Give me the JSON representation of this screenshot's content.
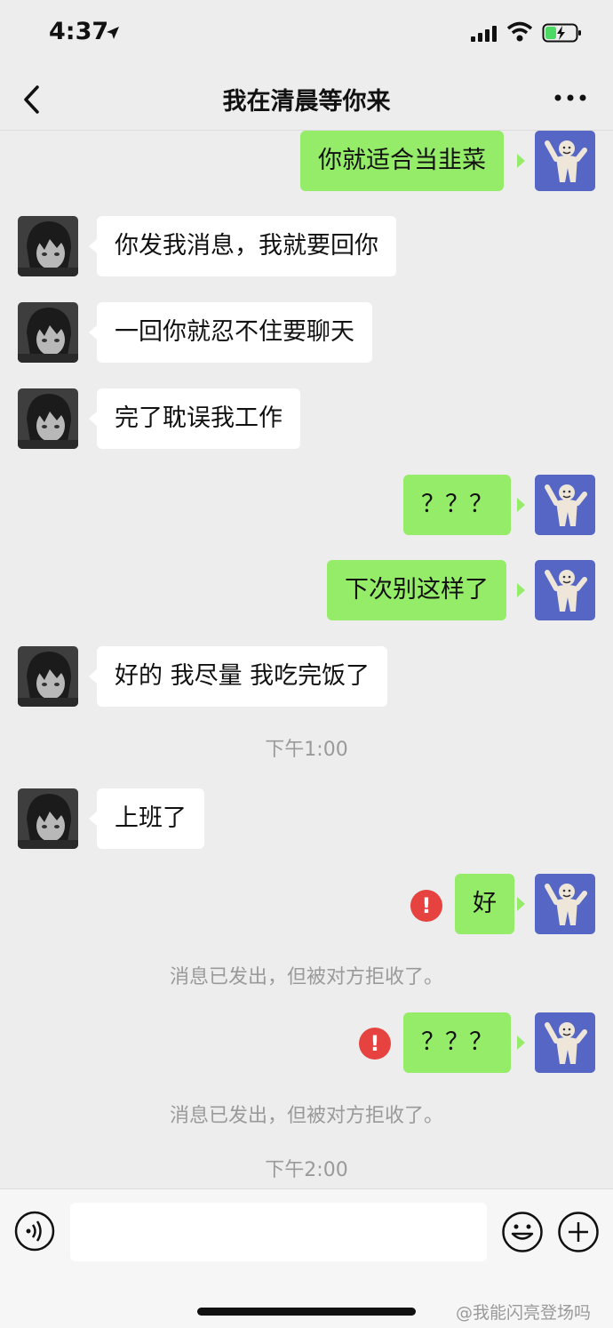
{
  "status": {
    "time": "4:37"
  },
  "header": {
    "title": "我在清晨等你来",
    "back_icon": "chevron-left-icon",
    "more_icon": "more-dots-icon"
  },
  "messages": [
    {
      "side": "out",
      "text": "你就适合当韭菜"
    },
    {
      "side": "in",
      "text": "你发我消息，我就要回你"
    },
    {
      "side": "in",
      "text": "一回你就忍不住要聊天"
    },
    {
      "side": "in",
      "text": "完了耽误我工作"
    },
    {
      "side": "out",
      "text": "？？？"
    },
    {
      "side": "out",
      "text": "下次别这样了"
    },
    {
      "side": "in",
      "text": "好的 我尽量 我吃完饭了"
    },
    {
      "side": "in",
      "text": "上班了"
    },
    {
      "side": "out",
      "text": "好",
      "failed": true
    },
    {
      "side": "out",
      "text": "？？？",
      "failed": true
    }
  ],
  "timestamps": [
    "下午1:00",
    "下午2:00"
  ],
  "system_notices": [
    "消息已发出，但被对方拒收了。",
    "消息已发出，但被对方拒收了。"
  ],
  "input": {
    "placeholder": ""
  },
  "watermark": "@我能闪亮登场吗",
  "colors": {
    "background": "#ededed",
    "outgoing_bubble": "#95ec69",
    "incoming_bubble": "#ffffff",
    "error": "#e64340"
  }
}
